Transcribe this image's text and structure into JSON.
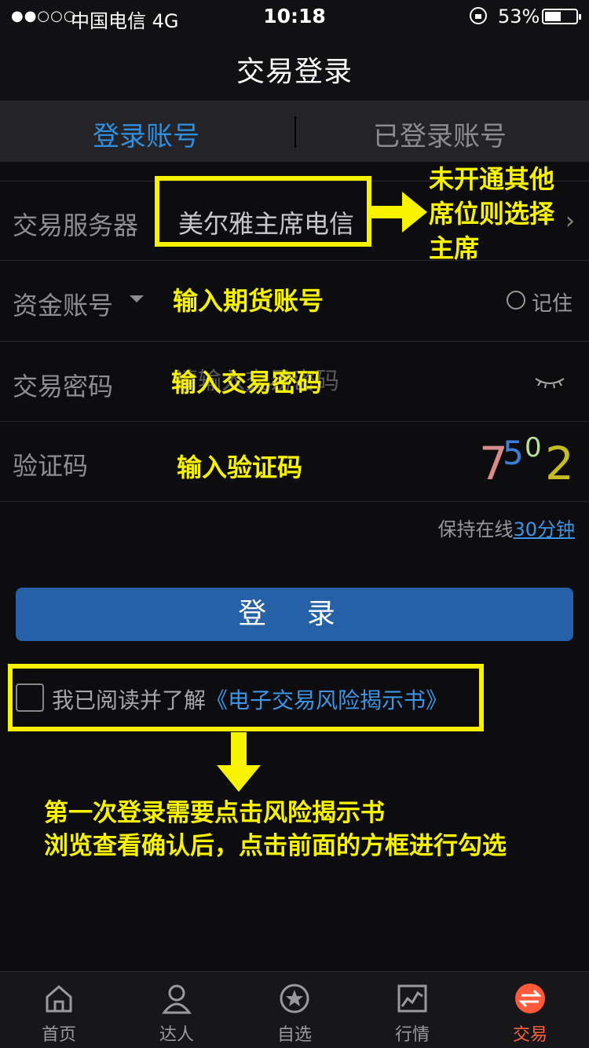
{
  "status_bar": {
    "signal": "●●○○○",
    "carrier": "中国电信  4G",
    "time": "10:18",
    "battery_percent": "53%",
    "battery_level": 0.53
  },
  "nav": {
    "title": "交易登录"
  },
  "tabs": [
    {
      "label": "登录账号",
      "active": true
    },
    {
      "label": "已登录账号",
      "active": false
    }
  ],
  "form": {
    "server": {
      "label": "交易服务器",
      "value": "美尔雅主席电信"
    },
    "fund_account": {
      "label": "资金账号",
      "placeholder": "",
      "remember_label": "记住"
    },
    "password": {
      "label": "交易密码",
      "placeholder": "请输入交易密码"
    },
    "captcha": {
      "label": "验证码",
      "placeholder": "",
      "digits": [
        "7",
        "5",
        "0",
        "2"
      ]
    },
    "keep_online_prefix": "保持在线",
    "keep_online_link": "30分钟",
    "login_button": "登 录",
    "agree_prefix": "我已阅读并了解",
    "agree_link": "《电子交易风险揭示书》"
  },
  "annotations": {
    "server_note_lines": [
      "未开通其他",
      "席位则选择",
      "主席"
    ],
    "fund_account_note": "输入期货账号",
    "password_note": "输入交易密码",
    "captcha_note": "输入验证码",
    "bottom_note_lines": [
      "第一次登录需要点击风险揭示书",
      "浏览查看确认后，点击前面的方框进行勾选"
    ]
  },
  "tab_bar": [
    {
      "label": "首页",
      "icon": "home-icon",
      "active": false
    },
    {
      "label": "达人",
      "icon": "person-icon",
      "active": false
    },
    {
      "label": "自选",
      "icon": "star-icon",
      "active": false
    },
    {
      "label": "行情",
      "icon": "chart-icon",
      "active": false
    },
    {
      "label": "交易",
      "icon": "trade-icon",
      "active": true
    }
  ],
  "colors": {
    "accent_blue": "#2f8fe0",
    "button_blue": "#2660a6",
    "annotation_yellow": "#f6f200",
    "active_tab_orange": "#ff6040"
  }
}
